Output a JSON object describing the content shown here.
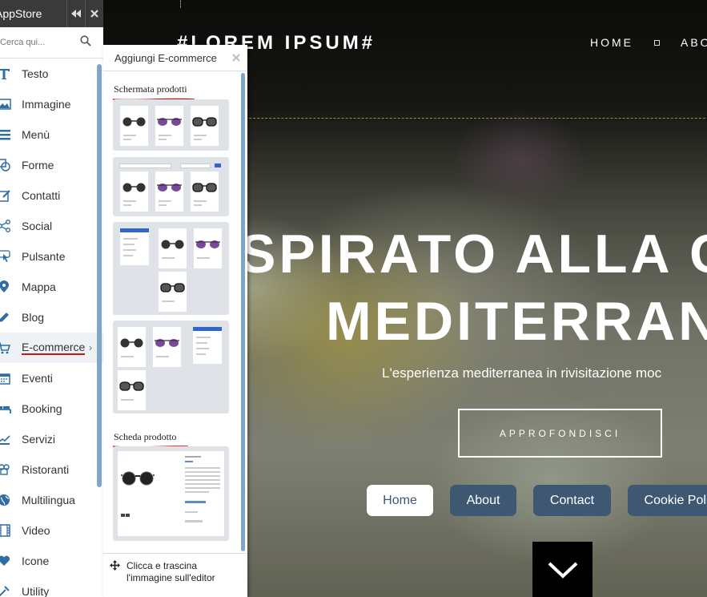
{
  "appstore": {
    "title": "AppStore",
    "search_placeholder": "Cerca qui...",
    "items": [
      {
        "label": "Testo",
        "icon": "text-icon"
      },
      {
        "label": "Immagine",
        "icon": "image-icon"
      },
      {
        "label": "Menù",
        "icon": "menu-icon"
      },
      {
        "label": "Forme",
        "icon": "shapes-icon"
      },
      {
        "label": "Contatti",
        "icon": "contact-icon"
      },
      {
        "label": "Social",
        "icon": "share-icon"
      },
      {
        "label": "Pulsante",
        "icon": "hand-pointer-icon"
      },
      {
        "label": "Mappa",
        "icon": "map-pin-icon"
      },
      {
        "label": "Blog",
        "icon": "pencil-icon"
      },
      {
        "label": "E-commerce",
        "icon": "cart-icon"
      },
      {
        "label": "Eventi",
        "icon": "calendar-icon"
      },
      {
        "label": "Booking",
        "icon": "bed-icon"
      },
      {
        "label": "Servizi",
        "icon": "services-icon"
      },
      {
        "label": "Ristoranti",
        "icon": "chef-icon"
      },
      {
        "label": "Multilingua",
        "icon": "globe-icon"
      },
      {
        "label": "Video",
        "icon": "film-icon"
      },
      {
        "label": "Icone",
        "icon": "heart-icon"
      },
      {
        "label": "Utility",
        "icon": "tools-icon"
      }
    ]
  },
  "panel": {
    "title": "Aggiungi E-commerce",
    "section_products": "Schermata prodotti",
    "section_product_card": "Scheda prodotto",
    "footer_line1": "Clicca e trascina",
    "footer_line2": "l'immagine sull'editor"
  },
  "site": {
    "logo": "#LOREM IPSUM#",
    "nav": [
      "HOME",
      "ABO"
    ],
    "headline_line1": "SPIRATO ALLA C",
    "headline_line2": "MEDITERRAN",
    "tagline": "L'esperienza mediterranea in rivisitazione moc",
    "cta": "APPROFONDISCI",
    "pills": [
      "Home",
      "About",
      "Contact",
      "Cookie Polic"
    ]
  },
  "colors": {
    "pill_bg": "#3e5874",
    "accent_blue": "#7fa6c9",
    "annotation_red": "#d01010",
    "header_dark": "#3a3a3a"
  }
}
